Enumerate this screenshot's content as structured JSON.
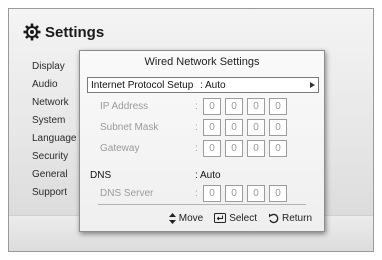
{
  "header": {
    "title": "Settings",
    "icon": "gear-icon"
  },
  "side_menu": [
    "Display",
    "Audio",
    "Network",
    "System",
    "Language",
    "Security",
    "General",
    "Support"
  ],
  "dialog": {
    "title": "Wired Network Settings",
    "ip_setup": {
      "label": "Internet Protocol Setup",
      "value": ": Auto"
    },
    "ip_address": {
      "label": "IP Address",
      "octets": [
        "0",
        "0",
        "0",
        "0"
      ]
    },
    "subnet_mask": {
      "label": "Subnet Mask",
      "octets": [
        "0",
        "0",
        "0",
        "0"
      ]
    },
    "gateway": {
      "label": "Gateway",
      "octets": [
        "0",
        "0",
        "0",
        "0"
      ]
    },
    "dns": {
      "label": "DNS",
      "value": ": Auto"
    },
    "dns_server": {
      "label": "DNS Server",
      "octets": [
        "0",
        "0",
        "0",
        "0"
      ]
    },
    "colon": ":"
  },
  "footer": {
    "move": "Move",
    "select": "Select",
    "return": "Return"
  }
}
